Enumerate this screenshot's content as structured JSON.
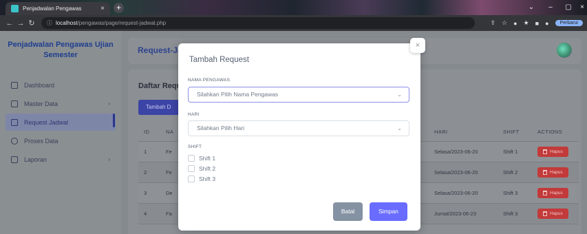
{
  "browser": {
    "tab_title": "Penjadwalan Pengawas",
    "url_host": "localhost",
    "url_path": "/pengawas/page/request-jadwal.php",
    "update_label": "Perbarui"
  },
  "sidebar": {
    "brand": "Penjadwalan Pengawas Ujian Semester",
    "items": [
      {
        "label": "Dashboard",
        "icon": "home-icon"
      },
      {
        "label": "Master Data",
        "icon": "table-icon"
      },
      {
        "label": "Request Jadwal",
        "icon": "check-square-icon"
      },
      {
        "label": "Proses Data",
        "icon": "gear-icon"
      },
      {
        "label": "Laporan",
        "icon": "file-icon"
      }
    ]
  },
  "header": {
    "title": "Request-Ja"
  },
  "content": {
    "section_title": "Daftar Requ",
    "add_button": "Tambah D",
    "columns": {
      "id": "ID",
      "nama": "NA",
      "hari": "HARI",
      "shift": "SHIFT",
      "actions": "ACTIONS"
    },
    "rows": [
      {
        "id": "1",
        "nama": "Fe",
        "hari": "Selasa/2023-06-20",
        "shift": "Shift 1",
        "action": "Hapus"
      },
      {
        "id": "2",
        "nama": "Fe",
        "hari": "Selasa/2023-06-20",
        "shift": "Shift 2",
        "action": "Hapus"
      },
      {
        "id": "3",
        "nama": "De",
        "hari": "Selasa/2023-06-20",
        "shift": "Shift 3",
        "action": "Hapus"
      },
      {
        "id": "4",
        "nama": "Fa",
        "hari": "Jumat/2023-06-23",
        "shift": "Shift 3",
        "action": "Hapus"
      }
    ]
  },
  "modal": {
    "title": "Tambah Request",
    "close": "×",
    "nama_label": "NAMA PENGAWAS",
    "nama_placeholder": "Silahkan Pilih Nama Pengawas",
    "hari_label": "HARI",
    "hari_placeholder": "Silahkan Pilih Hari",
    "shift_label": "SHIFT",
    "shifts": [
      "Shift 1",
      "Shift 2",
      "Shift 3"
    ],
    "cancel": "Batal",
    "save": "Simpan"
  }
}
